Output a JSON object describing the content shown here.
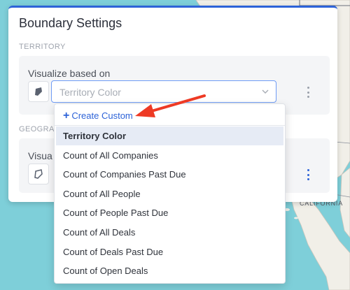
{
  "map": {
    "region_label": "CALIFORNIA",
    "water_color": "#7ecfd9",
    "land_color": "#f1efe8"
  },
  "panel": {
    "title": "Boundary Settings",
    "accent_color": "#2d63d8",
    "territory_section": {
      "label": "TERRITORY",
      "row_label": "Visualize based on",
      "icon": "territory-shape-icon",
      "select_value": "Territory Color",
      "select_icon": "chevron-down-icon",
      "menu_icon": "kebab-menu-icon"
    },
    "geography_section": {
      "label": "GEOGRA",
      "row_label": "Visua",
      "icon": "geography-shape-icon",
      "menu_icon": "kebab-menu-icon"
    }
  },
  "dropdown": {
    "create_label": "Create Custom",
    "create_icon": "plus-icon",
    "selected_index": 0,
    "options": [
      "Territory Color",
      "Count of All Companies",
      "Count of Companies Past Due",
      "Count of All People",
      "Count of People Past Due",
      "Count of All Deals",
      "Count of Deals Past Due",
      "Count of Open Deals"
    ]
  },
  "annotation": {
    "arrow_color": "#ee3a24"
  }
}
